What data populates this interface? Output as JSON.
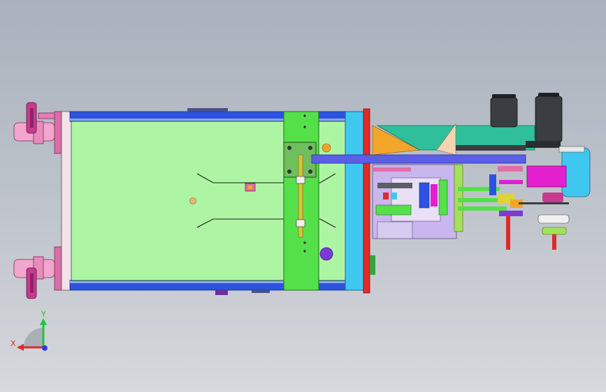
{
  "viewport": {
    "background_top": "#a9b1bc",
    "background_bottom": "#d5d8dc"
  },
  "colors": {
    "frame_blue": "#2c52e0",
    "table_green": "#aef5a3",
    "plate_green": "#55e04a",
    "rod_blue": "#5b5fe6",
    "cyan": "#3fc7ef",
    "red": "#e02a2a",
    "pink": "#e06fa6",
    "magenta": "#e31fd0",
    "orange": "#f3a52a",
    "teal": "#2fbf9a",
    "purple": "#7b3ad8",
    "motor_dark": "#3a3d42",
    "peach": "#f4d3b2",
    "lavender": "#c9b6ec"
  },
  "triad": {
    "y_label": "Y",
    "x_label": "X",
    "y_color": "#27c23a",
    "x_color": "#e02a2a",
    "z_color": "#2a3ee0"
  }
}
